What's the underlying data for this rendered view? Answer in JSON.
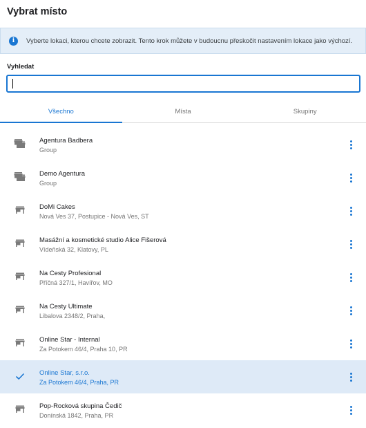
{
  "dialog": {
    "title": "Vybrat místo"
  },
  "info": {
    "icon": "info-icon",
    "text": "Vyberte lokaci, kterou chcete zobrazit. Tento krok můžete v budoucnu přeskočit nastavením lokace jako výchozí."
  },
  "search": {
    "label": "Vyhledat",
    "value": "",
    "placeholder": ""
  },
  "tabs": [
    {
      "label": "Všechno",
      "active": true
    },
    {
      "label": "Místa",
      "active": false
    },
    {
      "label": "Skupiny",
      "active": false
    }
  ],
  "colors": {
    "accent": "#1976d2",
    "selected_bg": "#deeaf7",
    "info_bg": "#e4eef8"
  },
  "items": [
    {
      "name": "Agentura Badbera",
      "sub": "Group",
      "icon": "group-store-icon",
      "selected": false
    },
    {
      "name": "Demo Agentura",
      "sub": "Group",
      "icon": "group-store-icon",
      "selected": false
    },
    {
      "name": "DoMi Cakes",
      "sub": "Nová Ves 37, Postupice - Nová Ves, ST",
      "icon": "store-icon",
      "selected": false
    },
    {
      "name": "Masážní a kosmetické studio Alice Fišerová",
      "sub": "Vídeňská 32, Klatovy, PL",
      "icon": "store-icon",
      "selected": false
    },
    {
      "name": "Na Cesty Profesional",
      "sub": "Příčná 327/1, Havířov, MO",
      "icon": "store-icon",
      "selected": false
    },
    {
      "name": "Na Cesty Ultimate",
      "sub": "Libalova 2348/2, Praha,",
      "icon": "store-icon",
      "selected": false
    },
    {
      "name": "Online Star - Internal",
      "sub": "Za Potokem 46/4, Praha 10, PR",
      "icon": "store-icon",
      "selected": false
    },
    {
      "name": "Online Star, s.r.o.",
      "sub": "Za Potokem 46/4, Praha, PR",
      "icon": "check-icon",
      "selected": true
    },
    {
      "name": "Pop-Rocková skupina Čedič",
      "sub": "Donínská 1842, Praha, PR",
      "icon": "store-icon",
      "selected": false
    }
  ]
}
